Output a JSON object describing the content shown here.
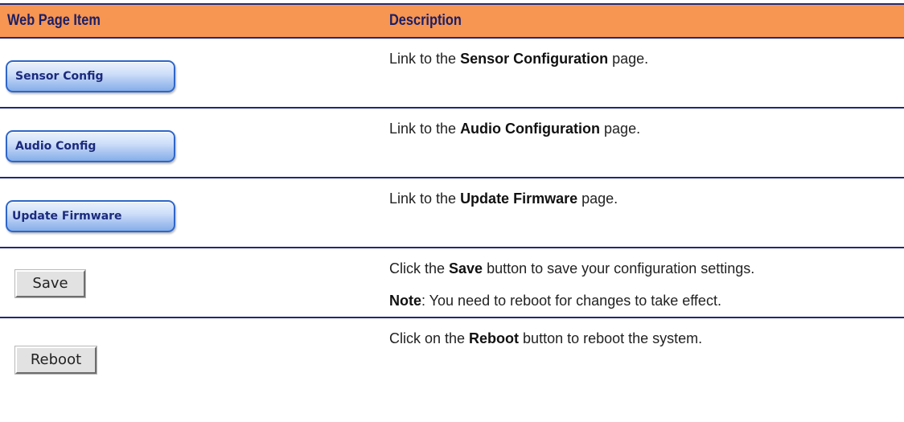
{
  "header": {
    "item_label": "Web Page Item",
    "description_label": "Description"
  },
  "rows": [
    {
      "button_label": "Sensor Config",
      "desc_prefix": "Link to the ",
      "desc_bold": "Sensor Configuration",
      "desc_suffix": " page."
    },
    {
      "button_label": "Audio Config",
      "desc_prefix": "Link to the ",
      "desc_bold": "Audio Configuration",
      "desc_suffix": " page."
    },
    {
      "button_label": "Update Firmware",
      "desc_prefix": "Link to the ",
      "desc_bold": "Update Firmware",
      "desc_suffix": " page."
    },
    {
      "button_label": "Save",
      "desc_prefix": "Click the ",
      "desc_bold": "Save",
      "desc_suffix": " button to save your configuration settings.",
      "note_bold": "Note",
      "note_text": ": You need to reboot for changes to take effect."
    },
    {
      "button_label": "Reboot",
      "desc_prefix": "Click on the ",
      "desc_bold": "Reboot",
      "desc_suffix": " button to reboot the system."
    }
  ],
  "colors": {
    "header_bg": "#f79553",
    "rule": "#1f2a78",
    "header_text": "#1a1f66",
    "blue_button_border": "#2f66c9",
    "blue_button_text": "#1c2a7c"
  }
}
